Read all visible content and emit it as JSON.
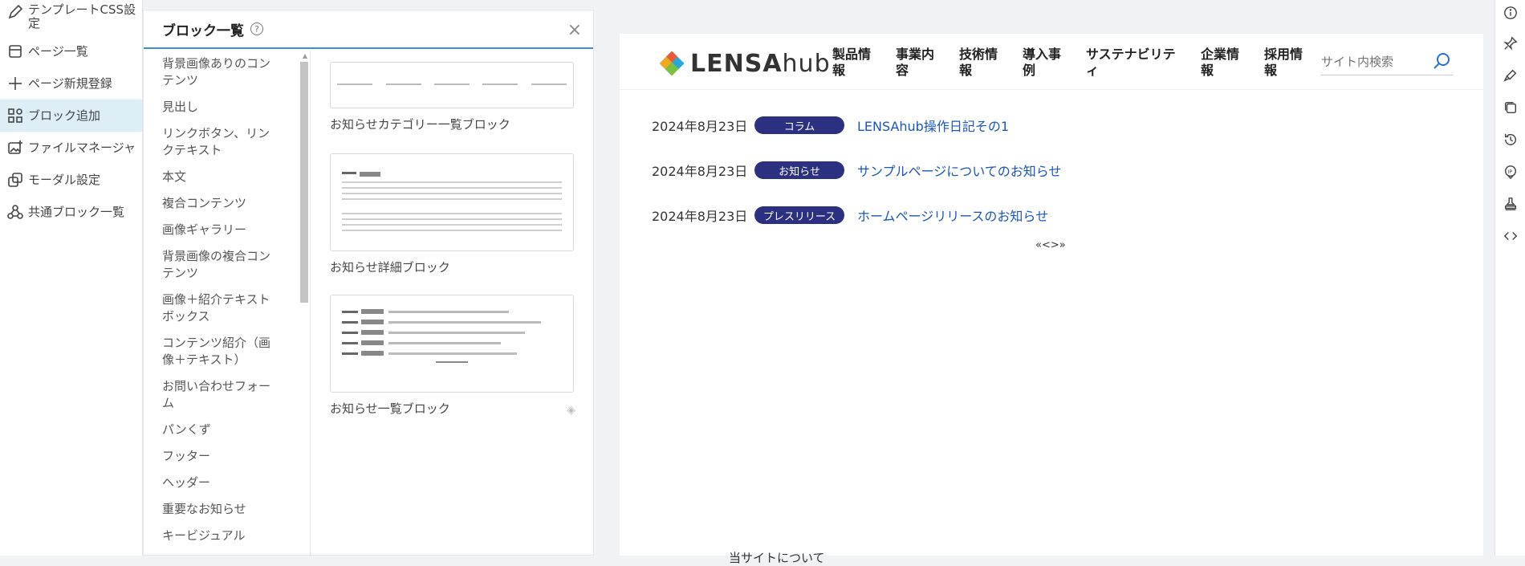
{
  "left_nav": [
    {
      "label": "テンプレートCSS設定",
      "icon": "pencil-icon"
    },
    {
      "label": "ページ一覧",
      "icon": "page-list-icon"
    },
    {
      "label": "ページ新規登録",
      "icon": "plus-icon"
    },
    {
      "label": "ブロック追加",
      "icon": "blocks-icon",
      "active": true
    },
    {
      "label": "ファイルマネージャ",
      "icon": "image-add-icon"
    },
    {
      "label": "モーダル設定",
      "icon": "modal-icon"
    },
    {
      "label": "共通ブロック一覧",
      "icon": "shared-blocks-icon"
    }
  ],
  "panel": {
    "title": "ブロック一覧",
    "help": "?",
    "close": "×",
    "categories": [
      "背景画像ありのコンテンツ",
      "見出し",
      "リンクボタン、リンクテキスト",
      "本文",
      "複合コンテンツ",
      "画像ギャラリー",
      "背景画像の複合コンテンツ",
      "画像＋紹介テキストボックス",
      "コンテンツ紹介（画像＋テキスト）",
      "お問い合わせフォーム",
      "パンくず",
      "フッター",
      "ヘッダー",
      "重要なお知らせ",
      "キービジュアル"
    ],
    "blocks": [
      {
        "label": "お知らせカテゴリー一覧ブロック"
      },
      {
        "label": "お知らせ詳細ブロック"
      },
      {
        "label": "お知らせ一覧ブロック"
      }
    ]
  },
  "preview": {
    "logo": {
      "main": "LENSA",
      "sub": "hub"
    },
    "nav": [
      "製品情報",
      "事業内容",
      "技術情報",
      "導入事例",
      "サステナビリティ",
      "企業情報",
      "採用情報"
    ],
    "search_placeholder": "サイト内検索",
    "news": [
      {
        "date": "2024年8月23日",
        "tag": "コラム",
        "title": "LENSAhub操作日記その1"
      },
      {
        "date": "2024年8月23日",
        "tag": "お知らせ",
        "title": "サンプルページについてのお知らせ"
      },
      {
        "date": "2024年8月23日",
        "tag": "プレスリリース",
        "title": "ホームページリリースのお知らせ"
      }
    ],
    "pager": "«<>»",
    "footer_peek": "当サイトについて"
  },
  "right_bar": [
    "info-icon",
    "pin-icon",
    "brush-icon",
    "layers-icon",
    "history-icon",
    "ip-icon",
    "stamp-icon",
    "code-icon"
  ]
}
